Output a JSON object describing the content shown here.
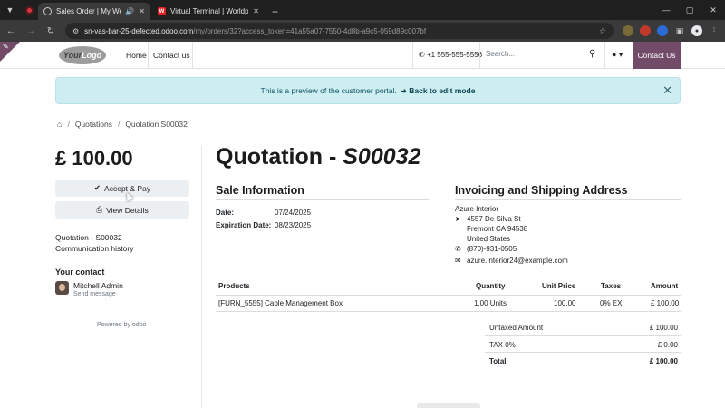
{
  "browser": {
    "tabs": [
      {
        "title": "Sales Order | My Website",
        "active": true
      },
      {
        "title": "Virtual Terminal | Worldpay das",
        "active": false
      }
    ],
    "new_tab": "+",
    "url_host": "sn-vas-bar-25-defected.odoo.com",
    "url_path": "/my/orders/32?access_token=41a55a07-7550-4d8b-a9c5-059d89c007bf"
  },
  "header": {
    "logo_your": "Your",
    "logo_logo": "Logo",
    "nav": [
      "Home",
      "Contact us"
    ],
    "phone": "+1 555-555-5556",
    "search_placeholder": "Search...",
    "contact_button": "Contact Us"
  },
  "alert": {
    "text": "This is a preview of the customer portal.",
    "link": "Back to edit mode"
  },
  "breadcrumb": {
    "items": [
      "Quotations",
      "Quotation S00032"
    ]
  },
  "sidebar": {
    "amount": "£ 100.00",
    "accept_pay": "Accept & Pay",
    "view_details": "View Details",
    "links": [
      "Quotation - S00032",
      "Communication history"
    ],
    "your_contact": "Your contact",
    "contact_name": "Mitchell Admin",
    "send_message": "Send message",
    "powered_by": "Powered by odoo"
  },
  "main": {
    "title_prefix": "Quotation - ",
    "title_number": "S00032",
    "sale_info_title": "Sale Information",
    "date_label": "Date:",
    "date_value": "07/24/2025",
    "expiration_label": "Expiration Date:",
    "expiration_value": "08/23/2025",
    "address_title": "Invoicing and Shipping Address",
    "address": {
      "name": "Azure Interior",
      "street": "4557 De Silva St",
      "city": "Fremont CA 94538",
      "country": "United States",
      "phone": "(870)-931-0505",
      "email": "azure.Interior24@example.com"
    },
    "table": {
      "headers": [
        "Products",
        "Quantity",
        "Unit Price",
        "Taxes",
        "Amount"
      ],
      "rows": [
        {
          "product": "[FURN_5555] Cable Management Box",
          "quantity": "1.00 Units",
          "unit_price": "100.00",
          "taxes": "0% EX",
          "amount": "£ 100.00"
        }
      ]
    },
    "totals": {
      "untaxed_label": "Untaxed Amount",
      "untaxed_value": "£ 100.00",
      "tax_label": "TAX 0%",
      "tax_value": "£ 0.00",
      "total_label": "Total",
      "total_value": "£ 100.00"
    }
  },
  "colors": {
    "brand": "#714b67",
    "alert_bg": "#cfeef2"
  }
}
